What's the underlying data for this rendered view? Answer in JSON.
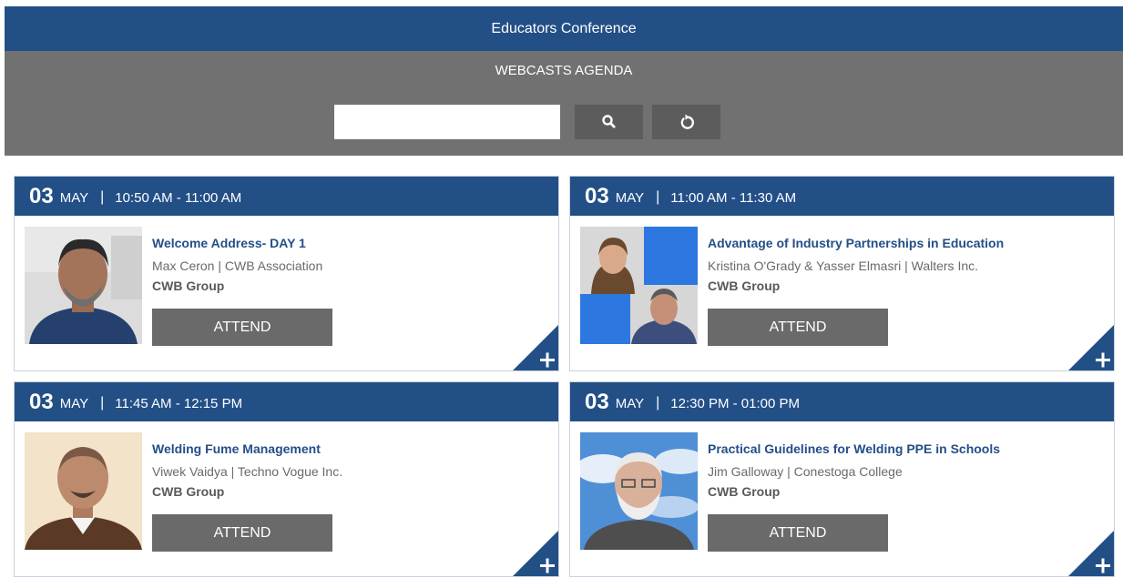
{
  "header": {
    "title": "Educators Conference"
  },
  "agenda": {
    "title": "WEBCASTS AGENDA",
    "search_placeholder": ""
  },
  "sessions": [
    {
      "day": "03",
      "month": "MAY",
      "time": "10:50 AM - 11:00 AM",
      "title": "Welcome Address- DAY 1",
      "speaker": "Max Ceron | CWB Association",
      "org": "CWB Group",
      "attend_label": "ATTEND"
    },
    {
      "day": "03",
      "month": "MAY",
      "time": "11:00 AM - 11:30 AM",
      "title": "Advantage of Industry Partnerships in Education",
      "speaker": "Kristina O'Grady & Yasser Elmasri | Walters Inc.",
      "org": "CWB Group",
      "attend_label": "ATTEND"
    },
    {
      "day": "03",
      "month": "MAY",
      "time": "11:45 AM - 12:15 PM",
      "title": "Welding Fume Management",
      "speaker": "Viwek Vaidya | Techno Vogue Inc.",
      "org": "CWB Group",
      "attend_label": "ATTEND"
    },
    {
      "day": "03",
      "month": "MAY",
      "time": "12:30 PM - 01:00 PM",
      "title": "Practical Guidelines for Welding PPE in Schools",
      "speaker": "Jim Galloway | Conestoga College",
      "org": "CWB Group",
      "attend_label": "ATTEND"
    }
  ],
  "colors": {
    "brand_blue": "#234f87",
    "panel_gray": "#717171",
    "button_gray": "#6a6a6a"
  },
  "icons": {
    "search": "search-icon",
    "reset": "refresh-icon",
    "expand": "plus-icon"
  }
}
